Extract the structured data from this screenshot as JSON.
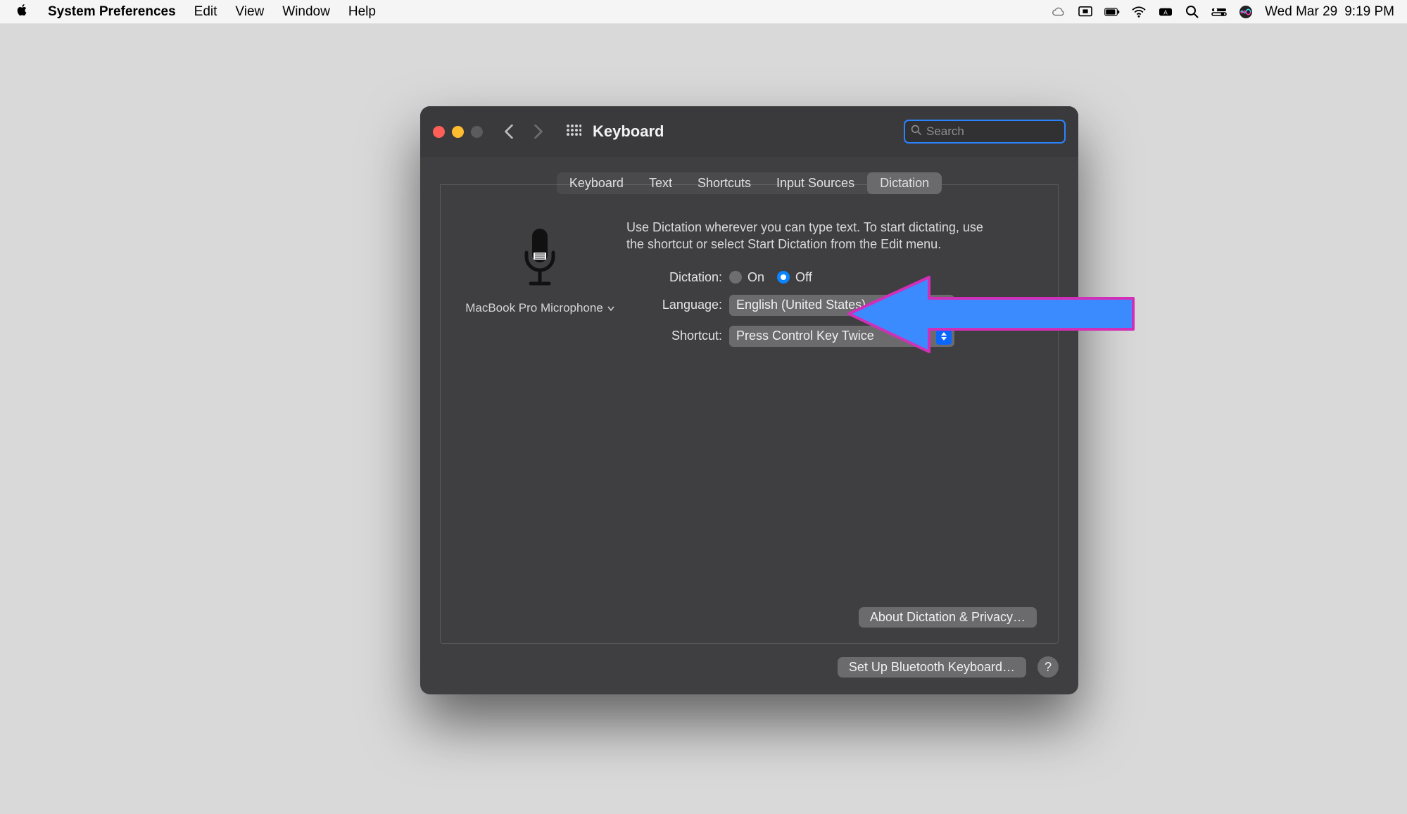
{
  "menubar": {
    "app": "System Preferences",
    "items": [
      "Edit",
      "View",
      "Window",
      "Help"
    ],
    "date": "Wed Mar 29",
    "time": "9:19 PM"
  },
  "window": {
    "title": "Keyboard",
    "search_placeholder": "Search",
    "tabs": [
      "Keyboard",
      "Text",
      "Shortcuts",
      "Input Sources",
      "Dictation"
    ],
    "active_tab": "Dictation",
    "mic_label": "MacBook Pro Microphone",
    "description": "Use Dictation wherever you can type text. To start dictating, use the shortcut or select Start Dictation from the Edit menu.",
    "dictation_label": "Dictation:",
    "dictation_on": "On",
    "dictation_off": "Off",
    "dictation_value": "Off",
    "language_label": "Language:",
    "language_value": "English (United States)",
    "shortcut_label": "Shortcut:",
    "shortcut_value": "Press Control Key Twice",
    "about_btn": "About Dictation & Privacy…",
    "bluetooth_btn": "Set Up Bluetooth Keyboard…",
    "help": "?"
  }
}
